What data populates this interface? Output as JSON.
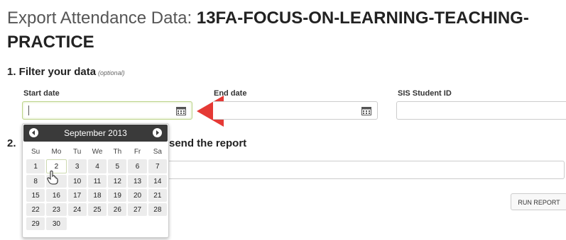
{
  "page": {
    "title_label": "Export Attendance Data:",
    "course_name_line1": "13FA-FOCUS-ON-LEARNING-TEACHING-",
    "course_name_line2": "PRACTICE"
  },
  "step1": {
    "heading": "1. Filter your data",
    "optional": "(optional)",
    "start_date": {
      "label": "Start date",
      "value": ""
    },
    "end_date": {
      "label": "End date",
      "value": ""
    },
    "sis_id": {
      "label": "SIS Student ID",
      "value": ""
    }
  },
  "step2": {
    "number": "2.",
    "heading_visible": "send the report"
  },
  "datepicker": {
    "month": "September 2013",
    "weekdays": [
      "Su",
      "Mo",
      "Tu",
      "We",
      "Th",
      "Fr",
      "Sa"
    ],
    "weeks": [
      [
        "1",
        "2",
        "3",
        "4",
        "5",
        "6",
        "7"
      ],
      [
        "8",
        "9",
        "10",
        "11",
        "12",
        "13",
        "14"
      ],
      [
        "15",
        "16",
        "17",
        "18",
        "19",
        "20",
        "21"
      ],
      [
        "22",
        "23",
        "24",
        "25",
        "26",
        "27",
        "28"
      ],
      [
        "29",
        "30",
        "",
        "",
        "",
        "",
        ""
      ]
    ],
    "hovered_day": "2"
  },
  "buttons": {
    "run_report": "RUN REPORT"
  },
  "colors": {
    "arrow": "#e53935",
    "datepicker_header": "#3a3a3a",
    "focused_border": "#bcd48a"
  }
}
